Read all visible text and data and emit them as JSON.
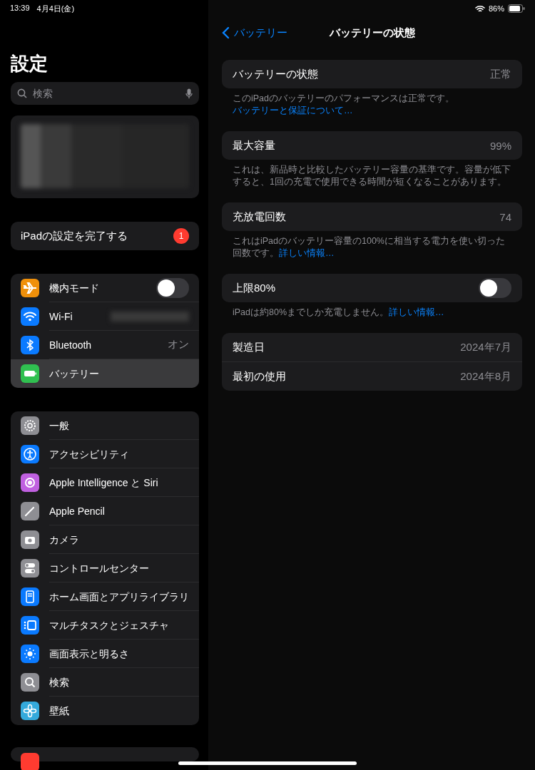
{
  "status_bar": {
    "time": "13:39",
    "date": "4月4日(金)",
    "battery": "86%"
  },
  "sidebar": {
    "title": "設定",
    "search": {
      "placeholder": "検索"
    },
    "setup": {
      "label": "iPadの設定を完了する",
      "badge": "1"
    },
    "groups": [
      {
        "items": [
          {
            "label": "機内モード",
            "kind": "toggle",
            "on": false,
            "selected": false
          },
          {
            "label": "Wi-Fi",
            "kind": "blurred",
            "selected": false
          },
          {
            "label": "Bluetooth",
            "kind": "value",
            "value": "オン",
            "selected": false
          },
          {
            "label": "バッテリー",
            "kind": "link",
            "selected": true
          }
        ]
      },
      {
        "items": [
          {
            "label": "一般",
            "kind": "link",
            "selected": false
          },
          {
            "label": "アクセシビリティ",
            "kind": "link",
            "selected": false
          },
          {
            "label": "Apple Intelligence と Siri",
            "kind": "link",
            "selected": false
          },
          {
            "label": "Apple Pencil",
            "kind": "link",
            "selected": false
          },
          {
            "label": "カメラ",
            "kind": "link",
            "selected": false
          },
          {
            "label": "コントロールセンター",
            "kind": "link",
            "selected": false
          },
          {
            "label": "ホーム画面とアプリライブラリ",
            "kind": "link",
            "selected": false
          },
          {
            "label": "マルチタスクとジェスチャ",
            "kind": "link",
            "selected": false
          },
          {
            "label": "画面表示と明るさ",
            "kind": "link",
            "selected": false
          },
          {
            "label": "検索",
            "kind": "link",
            "selected": false
          },
          {
            "label": "壁紙",
            "kind": "link",
            "selected": false
          }
        ]
      }
    ]
  },
  "detail": {
    "back": "バッテリー",
    "title": "バッテリーの状態",
    "sections": [
      {
        "rows": [
          {
            "label": "バッテリーの状態",
            "kind": "value",
            "value": "正常"
          }
        ],
        "footer": "このiPadのバッテリーのパフォーマンスは正常です。",
        "footer_link": "バッテリーと保証について…"
      },
      {
        "rows": [
          {
            "label": "最大容量",
            "kind": "value",
            "value": "99%"
          }
        ],
        "footer": "これは、新品時と比較したバッテリー容量の基準です。容量が低下すると、1回の充電で使用できる時間が短くなることがあります。"
      },
      {
        "rows": [
          {
            "label": "充放電回数",
            "kind": "value",
            "value": "74"
          }
        ],
        "footer": "これはiPadのバッテリー容量の100%に相当する電力を使い切った回数です。",
        "footer_link": "詳しい情報…"
      },
      {
        "rows": [
          {
            "label": "上限80%",
            "kind": "toggle",
            "on": false
          }
        ],
        "footer": "iPadは約80%までしか充電しません。",
        "footer_link": "詳しい情報…"
      },
      {
        "rows": [
          {
            "label": "製造日",
            "kind": "value",
            "value": "2024年7月"
          },
          {
            "label": "最初の使用",
            "kind": "value",
            "value": "2024年8月"
          }
        ]
      }
    ]
  }
}
